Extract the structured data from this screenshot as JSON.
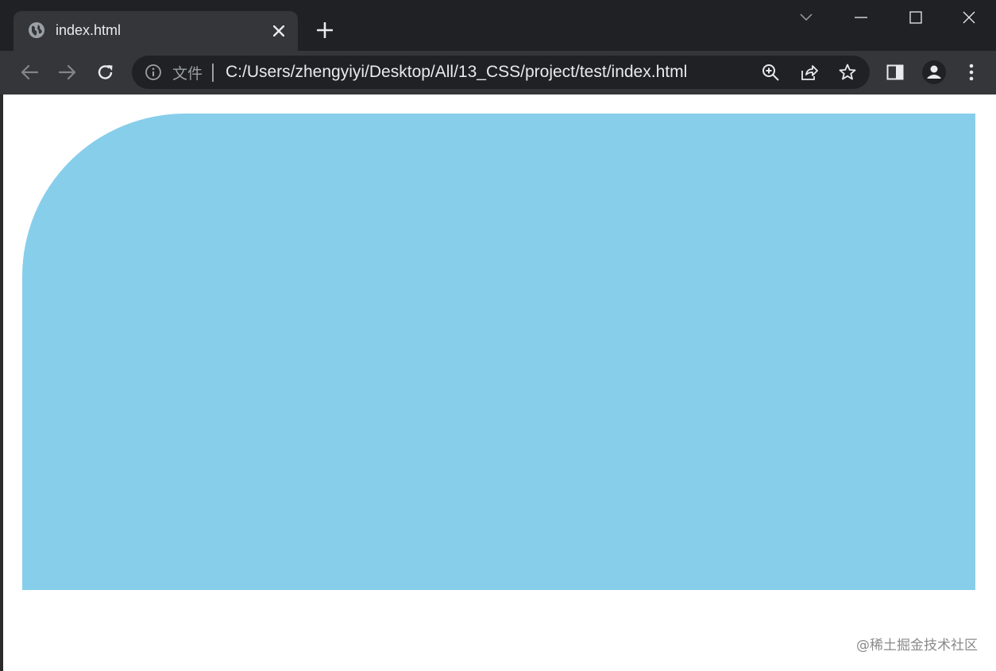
{
  "browser": {
    "tab": {
      "title": "index.html",
      "favicon_icon": "globe-icon",
      "close_icon": "close-icon"
    },
    "new_tab_icon": "plus-icon",
    "window_controls": [
      "tab-search-icon",
      "minimize-icon",
      "maximize-icon",
      "close-window-icon"
    ],
    "nav": [
      "back-icon",
      "forward-icon",
      "reload-icon"
    ],
    "omnibox": {
      "info_icon": "info-icon",
      "chip": "文件",
      "url": "C:/Users/zhengyiyi/Desktop/All/13_CSS/project/test/index.html",
      "actions": [
        "zoom-icon",
        "share-icon",
        "bookmark-star-icon"
      ]
    },
    "toolbar_right": [
      "side-panel-icon",
      "profile-icon",
      "menu-kebab-icon"
    ],
    "colors": {
      "tabstrip": "#202124",
      "toolbar": "#35363a",
      "omnibox": "#202124",
      "text": "#e8eaed"
    }
  },
  "page": {
    "background": "#ffffff",
    "box_color": "#87ceeb",
    "watermark": "@稀土掘金技术社区"
  }
}
